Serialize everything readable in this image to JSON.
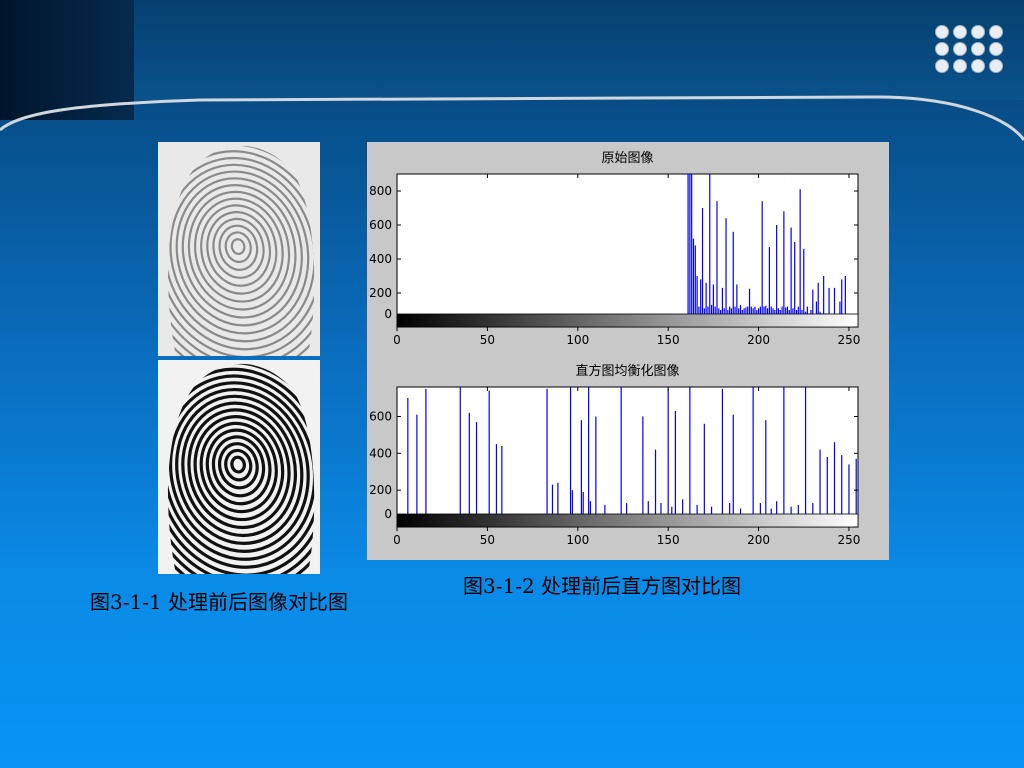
{
  "captions": {
    "left": "图3-1-1 处理前后图像对比图",
    "right": "图3-1-2 处理前后直方图对比图"
  },
  "images": {
    "top": "fingerprint-original",
    "bottom": "fingerprint-equalized"
  },
  "colors": {
    "bar": "#0000ff",
    "figure_bg": "#c8c8c8",
    "axes_bg": "#ffffff",
    "caption": "#000000"
  },
  "chart_data": [
    {
      "type": "bar",
      "title": "原始图像",
      "xlabel": "",
      "ylabel": "",
      "xlim": [
        0,
        255
      ],
      "ylim": [
        0,
        900
      ],
      "xticks": [
        0,
        50,
        100,
        150,
        200,
        250
      ],
      "yticks": [
        0,
        200,
        400,
        600,
        800
      ],
      "colorbar": "grayscale",
      "x": [
        134,
        160,
        161,
        162,
        163,
        164,
        165,
        166,
        167,
        168,
        169,
        170,
        171,
        172,
        173,
        174,
        175,
        176,
        177,
        178,
        179,
        180,
        181,
        182,
        183,
        184,
        185,
        186,
        187,
        188,
        189,
        190,
        191,
        192,
        193,
        194,
        195,
        196,
        197,
        198,
        199,
        200,
        201,
        202,
        203,
        204,
        205,
        206,
        207,
        208,
        209,
        210,
        211,
        212,
        213,
        214,
        215,
        216,
        217,
        218,
        219,
        220,
        221,
        222,
        223,
        224,
        225,
        226,
        227,
        228,
        229,
        230,
        231,
        232,
        233,
        234,
        235,
        236,
        237,
        238,
        239,
        240,
        241,
        242,
        243,
        244,
        245,
        246,
        247,
        248,
        249,
        250
      ],
      "values": [
        15,
        30,
        900,
        900,
        900,
        520,
        480,
        300,
        120,
        280,
        700,
        110,
        260,
        120,
        900,
        130,
        250,
        120,
        740,
        110,
        100,
        230,
        110,
        640,
        100,
        120,
        110,
        560,
        120,
        250,
        110,
        130,
        100,
        110,
        115,
        120,
        225,
        120,
        110,
        120,
        100,
        110,
        120,
        740,
        120,
        125,
        110,
        470,
        120,
        110,
        100,
        600,
        110,
        100,
        120,
        680,
        115,
        120,
        100,
        585,
        110,
        500,
        100,
        120,
        810,
        100,
        460,
        90,
        120,
        80,
        100,
        220,
        70,
        150,
        260,
        90,
        80,
        300,
        80,
        60,
        230,
        40,
        40,
        230,
        60,
        40,
        150,
        280,
        30,
        300,
        20,
        10
      ]
    },
    {
      "type": "bar",
      "title": "直方图均衡化图像",
      "xlabel": "",
      "ylabel": "",
      "xlim": [
        0,
        255
      ],
      "ylim": [
        0,
        760
      ],
      "xticks": [
        0,
        50,
        100,
        150,
        200,
        250
      ],
      "yticks": [
        0,
        200,
        400,
        600
      ],
      "colorbar": "grayscale",
      "x": [
        6,
        11,
        16,
        35,
        40,
        44,
        51,
        55,
        58,
        83,
        86,
        89,
        96,
        97,
        102,
        103,
        106,
        107,
        110,
        115,
        124,
        127,
        136,
        139,
        143,
        146,
        150,
        152,
        154,
        158,
        162,
        166,
        170,
        174,
        180,
        184,
        186,
        190,
        197,
        201,
        204,
        207,
        210,
        214,
        218,
        222,
        226,
        230,
        234,
        238,
        242,
        246,
        250,
        254
      ],
      "values": [
        700,
        610,
        750,
        760,
        620,
        570,
        740,
        450,
        440,
        750,
        230,
        240,
        760,
        200,
        580,
        190,
        770,
        140,
        600,
        120,
        760,
        130,
        600,
        140,
        420,
        130,
        750,
        110,
        630,
        150,
        760,
        120,
        560,
        110,
        750,
        130,
        610,
        100,
        760,
        130,
        580,
        100,
        140,
        760,
        110,
        120,
        760,
        130,
        420,
        380,
        460,
        390,
        340,
        370
      ]
    }
  ]
}
